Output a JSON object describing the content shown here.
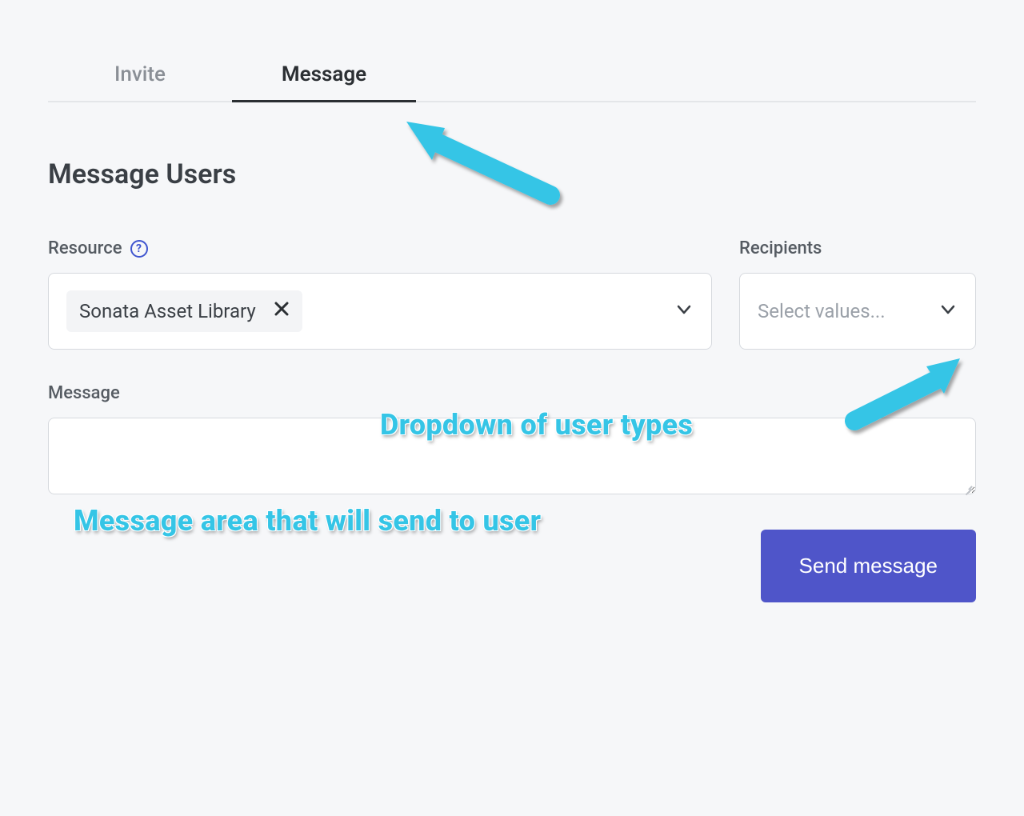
{
  "tabs": {
    "invite": "Invite",
    "message": "Message",
    "active": "message"
  },
  "section": {
    "title": "Message Users"
  },
  "resource": {
    "label": "Resource",
    "help_tooltip": "?",
    "selected_chip": "Sonata Asset Library"
  },
  "recipients": {
    "label": "Recipients",
    "placeholder": "Select values..."
  },
  "message": {
    "label": "Message",
    "value": ""
  },
  "actions": {
    "send_label": "Send message"
  },
  "annotations": {
    "dropdown_callout": "Dropdown of user types",
    "message_area_callout": "Message area that will send to user"
  },
  "colors": {
    "accent_blue": "#4f55c9",
    "callout_cyan": "#35c5e6"
  }
}
